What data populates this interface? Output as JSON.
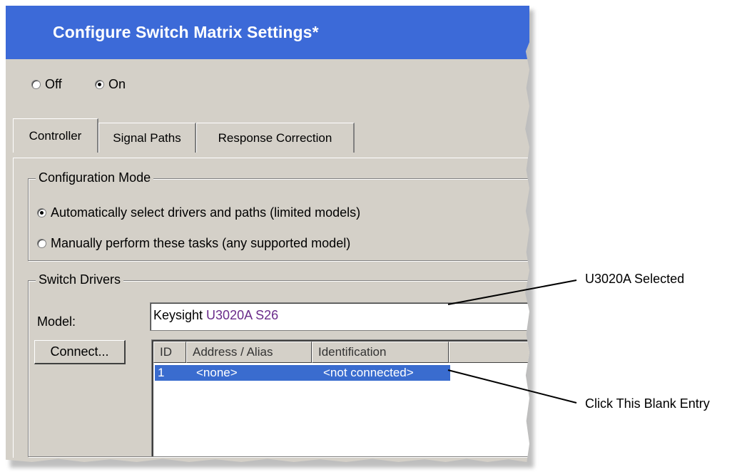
{
  "window": {
    "title": "Configure Switch Matrix Settings*"
  },
  "power": {
    "off_label": "Off",
    "on_label": "On",
    "selected": "On"
  },
  "tabs": [
    {
      "label": "Controller",
      "active": true
    },
    {
      "label": "Signal Paths",
      "active": false
    },
    {
      "label": "Response Correction",
      "active": false
    }
  ],
  "configuration_mode": {
    "title": "Configuration Mode",
    "options": [
      {
        "label": "Automatically select drivers and paths (limited models)",
        "selected": true
      },
      {
        "label": "Manually perform these tasks (any supported model)",
        "selected": false
      }
    ]
  },
  "switch_drivers": {
    "title": "Switch Drivers",
    "model_label": "Model:",
    "model_value_brand": "Keysight ",
    "model_value_part": "U3020A S26",
    "connect_button": "Connect...",
    "table": {
      "columns": [
        "ID",
        "Address / Alias",
        "Identification"
      ],
      "rows": [
        {
          "id": "1",
          "address": "<none>",
          "identification": "<not connected>",
          "selected": true
        }
      ]
    }
  },
  "annotations": {
    "model_callout": "U3020A Selected",
    "entry_callout": "Click This Blank Entry"
  },
  "colors": {
    "titlebar": "#3c6ad8",
    "dialog_bg": "#d4d0c8",
    "selection": "#3a6ccf",
    "model_part": "#6a2b8a"
  }
}
